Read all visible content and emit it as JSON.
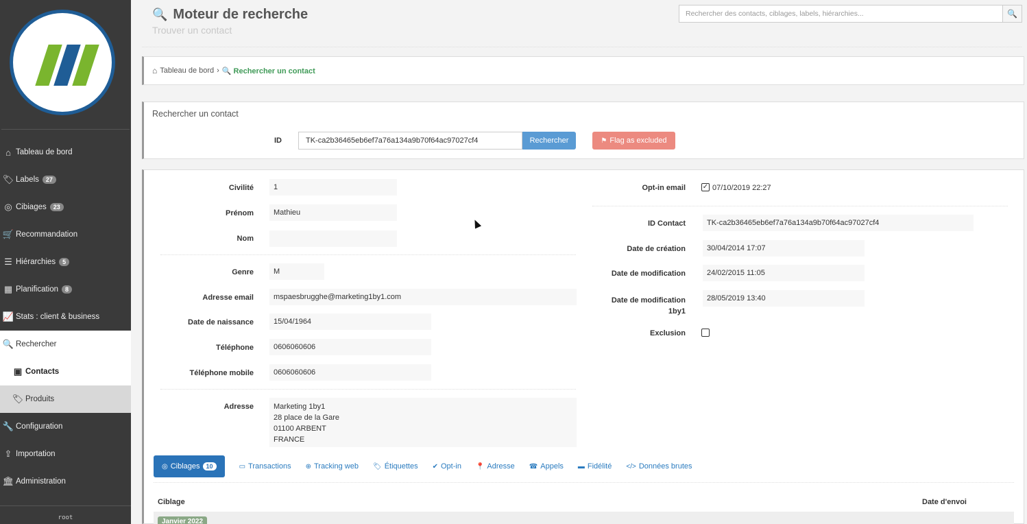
{
  "sidebar": {
    "logo_text": "111",
    "items": [
      {
        "label": "Tableau de bord",
        "badge": ""
      },
      {
        "label": "Labels",
        "badge": "27"
      },
      {
        "label": "Cibiages",
        "badge": "23"
      },
      {
        "label": "Recommandation",
        "badge": ""
      },
      {
        "label": "Hiérarchies",
        "badge": "5"
      },
      {
        "label": "Planification",
        "badge": "8"
      },
      {
        "label": "Stats : client & business",
        "badge": ""
      },
      {
        "label": "Rechercher",
        "badge": ""
      },
      {
        "label": "Contacts",
        "badge": ""
      },
      {
        "label": "Produits",
        "badge": ""
      },
      {
        "label": "Configuration",
        "badge": ""
      },
      {
        "label": "Importation",
        "badge": ""
      },
      {
        "label": "Administration",
        "badge": ""
      }
    ],
    "user": "root"
  },
  "header": {
    "title": "Moteur de recherche",
    "subtitle": "Trouver un contact",
    "search_placeholder": "Rechercher des contacts, ciblages, labels, hiérarchies..."
  },
  "breadcrumb": {
    "home": "Tableau de bord",
    "current": "Rechercher un contact"
  },
  "search_panel": {
    "title": "Rechercher un contact",
    "id_label": "ID",
    "id_value": "TK-ca2b36465eb6ef7a76a134a9b70f64ac97027cf4",
    "search_button": "Rechercher",
    "flag_button": "Flag as excluded"
  },
  "contact": {
    "civilite_label": "Civilité",
    "civilite": "1",
    "prenom_label": "Prénom",
    "prenom": "Mathieu",
    "nom_label": "Nom",
    "nom": "",
    "genre_label": "Genre",
    "genre": "M",
    "email_label": "Adresse email",
    "email": "mspaesbrugghe@marketing1by1.com",
    "naissance_label": "Date de naissance",
    "naissance": "15/04/1964",
    "telephone_label": "Téléphone",
    "telephone": "0606060606",
    "mobile_label": "Téléphone mobile",
    "mobile": "0606060606",
    "adresse_label": "Adresse",
    "adresse_lines": [
      "Marketing 1by1",
      "28 place de la Gare",
      "01100 ARBENT",
      "FRANCE"
    ],
    "optin_label": "Opt-in email",
    "optin_value": "07/10/2019 22:27",
    "id_contact_label": "ID Contact",
    "id_contact": "TK-ca2b36465eb6ef7a76a134a9b70f64ac97027cf4",
    "creation_label": "Date de création",
    "creation": "30/04/2014 17:07",
    "modification_label": "Date de modification",
    "modification": "24/02/2015 11:05",
    "modification_1by1_label_line1": "Date de modification",
    "modification_1by1_label_line2": "1by1",
    "modification_1by1": "28/05/2019 13:40",
    "exclusion_label": "Exclusion"
  },
  "tabs": [
    {
      "label": "Ciblages",
      "count": "10"
    },
    {
      "label": "Transactions"
    },
    {
      "label": "Tracking web"
    },
    {
      "label": "Étiquettes"
    },
    {
      "label": "Opt-in"
    },
    {
      "label": "Adresse"
    },
    {
      "label": "Appels"
    },
    {
      "label": "Fidélité"
    },
    {
      "label": "Données brutes"
    }
  ],
  "table": {
    "col_ciblage": "Ciblage",
    "col_date": "Date d'envoi",
    "first_row_badge": "Janvier 2022"
  },
  "colors": {
    "sidebar_bg": "#3a3a3a",
    "accent_blue": "#2a73b8",
    "flag_red": "#ec8a80",
    "breadcrumb_green": "#3f9a57"
  }
}
